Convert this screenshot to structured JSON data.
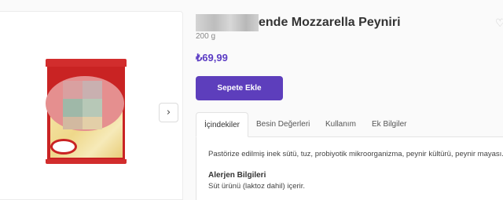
{
  "product": {
    "title": "ende Mozzarella Peyniri",
    "weight": "200 g",
    "price": "₺69,99",
    "add_to_cart_label": "Sepete Ekle"
  },
  "gallery": {
    "next_icon": "chevron-right-icon",
    "next_glyph": "›"
  },
  "favorite": {
    "icon": "heart-icon",
    "glyph": "♡"
  },
  "tabs": [
    {
      "label": "İçindekiler",
      "active": true
    },
    {
      "label": "Besin Değerleri",
      "active": false
    },
    {
      "label": "Kullanım",
      "active": false
    },
    {
      "label": "Ek Bilgiler",
      "active": false
    }
  ],
  "details": {
    "ingredients": "Pastörize edilmiş inek sütü, tuz, probiyotik mikroorganizma, peynir kültürü, peynir mayası.",
    "allergen_title": "Alerjen Bilgileri",
    "allergen_text": "Süt ürünü (laktoz dahil) içerir."
  },
  "colors": {
    "accent": "#5d3ebc",
    "price": "#5b3cc4",
    "package_red": "#c92323"
  }
}
